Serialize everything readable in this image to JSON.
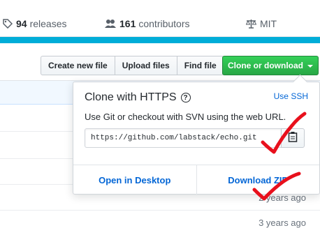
{
  "stats": {
    "releases": {
      "count": "94",
      "label": "releases",
      "icon": "tag-icon"
    },
    "contributors": {
      "count": "161",
      "label": "contributors",
      "icon": "people-icon"
    },
    "license": {
      "label": "MIT",
      "icon": "law-icon"
    },
    "language_bar_color": "#00add8"
  },
  "toolbar": {
    "create_file": "Create new file",
    "upload_files": "Upload files",
    "find_file": "Find file",
    "clone_or_download": "Clone or download"
  },
  "clone_popover": {
    "title": "Clone with HTTPS",
    "switch_link": "Use SSH",
    "description": "Use Git or checkout with SVN using the web URL.",
    "url": "https://github.com/labstack/echo.git",
    "open_desktop": "Open in Desktop",
    "download_zip": "Download ZIP"
  },
  "file_list": {
    "visible_ages": [
      "2 years ago",
      "3 years ago"
    ]
  },
  "colors": {
    "accent_green": "#28a745",
    "link_blue": "#0366d6",
    "annotation_red": "#e8101c"
  }
}
